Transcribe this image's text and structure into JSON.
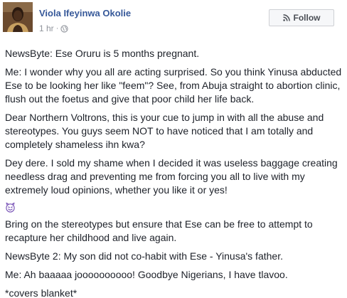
{
  "post": {
    "author_name": "Viola Ifeyinwa Okolie",
    "timestamp": "1 hr",
    "meta_separator": "·",
    "audience_icon": "globe-icon",
    "follow_label": "Follow",
    "follow_icon": "rss-icon",
    "emoji_icon": "devil-smile-icon",
    "paragraphs_before_emoji": [
      "NewsByte: Ese Oruru is 5 months pregnant.",
      "Me: I wonder why you all are acting surprised. So you think Yinusa abducted Ese to be looking her like \"feem\"? See, from Abuja straight to abortion clinic, flush out the foetus and give that poor child her life back.",
      "Dear Northern Voltrons, this is your cue to jump in with all the abuse and stereotypes. You guys seem NOT to have noticed that I am totally and completely shameless ihn kwa?",
      "Dey dere. I sold my shame when I decided it was useless baggage creating needless drag and preventing me from forcing you all to live with my extremely loud opinions, whether you like it or yes!"
    ],
    "paragraphs_after_emoji": [
      "Bring on the stereotypes but ensure that Ese can be free to attempt to recapture her childhood and live again.",
      "NewsByte 2: My son did not co-habit with Ese - Yinusa's father.",
      "Me: Ah baaaaa joooooooooo! Goodbye Nigerians, I have tlavoo.",
      "*covers blanket*"
    ]
  },
  "colors": {
    "author_link": "#365899",
    "meta_gray": "#90949c",
    "body_text": "#1d2129",
    "button_bg": "#f6f7f9",
    "button_border": "#ced0d4"
  }
}
